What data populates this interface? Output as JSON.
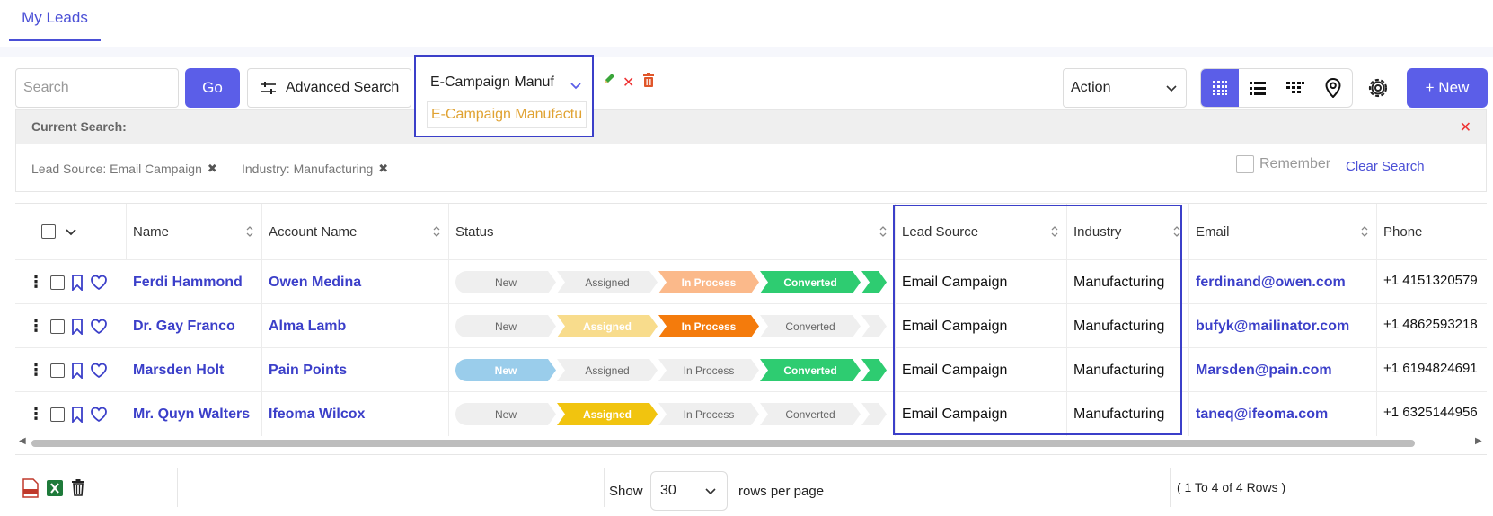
{
  "tabs": [
    {
      "label": "My Leads"
    }
  ],
  "toolbar": {
    "search_placeholder": "Search",
    "go_label": "Go",
    "advanced_label": "Advanced Search",
    "saved_search_value": "E-Campaign Manuf",
    "saved_search_option": "E-Campaign Manufactu",
    "action_label": "Action",
    "new_label": "+ New"
  },
  "current_search": {
    "title": "Current Search:",
    "chips": [
      "Lead Source: Email Campaign",
      "Industry: Manufacturing"
    ],
    "remember_label": "Remember",
    "clear_label": "Clear Search"
  },
  "table": {
    "headers": {
      "name": "Name",
      "account": "Account Name",
      "status": "Status",
      "lead_source": "Lead Source",
      "industry": "Industry",
      "email": "Email",
      "phone": "Phone"
    },
    "stages": [
      "New",
      "Assigned",
      "In Process",
      "Converted"
    ],
    "rows": [
      {
        "name": "Ferdi Hammond",
        "account": "Owen Medina",
        "lead_source": "Email Campaign",
        "industry": "Manufacturing",
        "email": "ferdinand@owen.com",
        "phone": "+1 4151320579",
        "stage_colors": [
          "#efefef",
          "#efefef",
          "#fbb98a",
          "#2ecc71",
          "#2ecc71"
        ],
        "stage_text": [
          "#666",
          "#666",
          "#fff",
          "#fff"
        ]
      },
      {
        "name": "Dr. Gay Franco",
        "account": "Alma Lamb",
        "lead_source": "Email Campaign",
        "industry": "Manufacturing",
        "email": "bufyk@mailinator.com",
        "phone": "+1 4862593218",
        "stage_colors": [
          "#efefef",
          "#f8dc8c",
          "#f47b0c",
          "#efefef",
          "#efefef"
        ],
        "stage_text": [
          "#666",
          "#fff",
          "#fff",
          "#666"
        ]
      },
      {
        "name": "Marsden Holt",
        "account": "Pain Points",
        "lead_source": "Email Campaign",
        "industry": "Manufacturing",
        "email": "Marsden@pain.com",
        "phone": "+1 6194824691",
        "stage_colors": [
          "#9acdeb",
          "#efefef",
          "#efefef",
          "#2ecc71",
          "#2ecc71"
        ],
        "stage_text": [
          "#fff",
          "#666",
          "#666",
          "#fff"
        ]
      },
      {
        "name": "Mr. Quyn Walters",
        "account": "Ifeoma Wilcox",
        "lead_source": "Email Campaign",
        "industry": "Manufacturing",
        "email": "taneq@ifeoma.com",
        "phone": "+1 6325144956",
        "stage_colors": [
          "#efefef",
          "#f1c40f",
          "#efefef",
          "#efefef",
          "#efefef"
        ],
        "stage_text": [
          "#666",
          "#fff",
          "#666",
          "#666"
        ]
      }
    ]
  },
  "footer": {
    "show_label": "Show",
    "rows_value": "30",
    "rows_per_page_label": "rows per page",
    "range_label": "( 1 To 4 of 4 Rows )"
  },
  "colors": {
    "accent": "#5b5ee8",
    "link": "#3b3fc9",
    "highlight": "#3b3fc9"
  }
}
